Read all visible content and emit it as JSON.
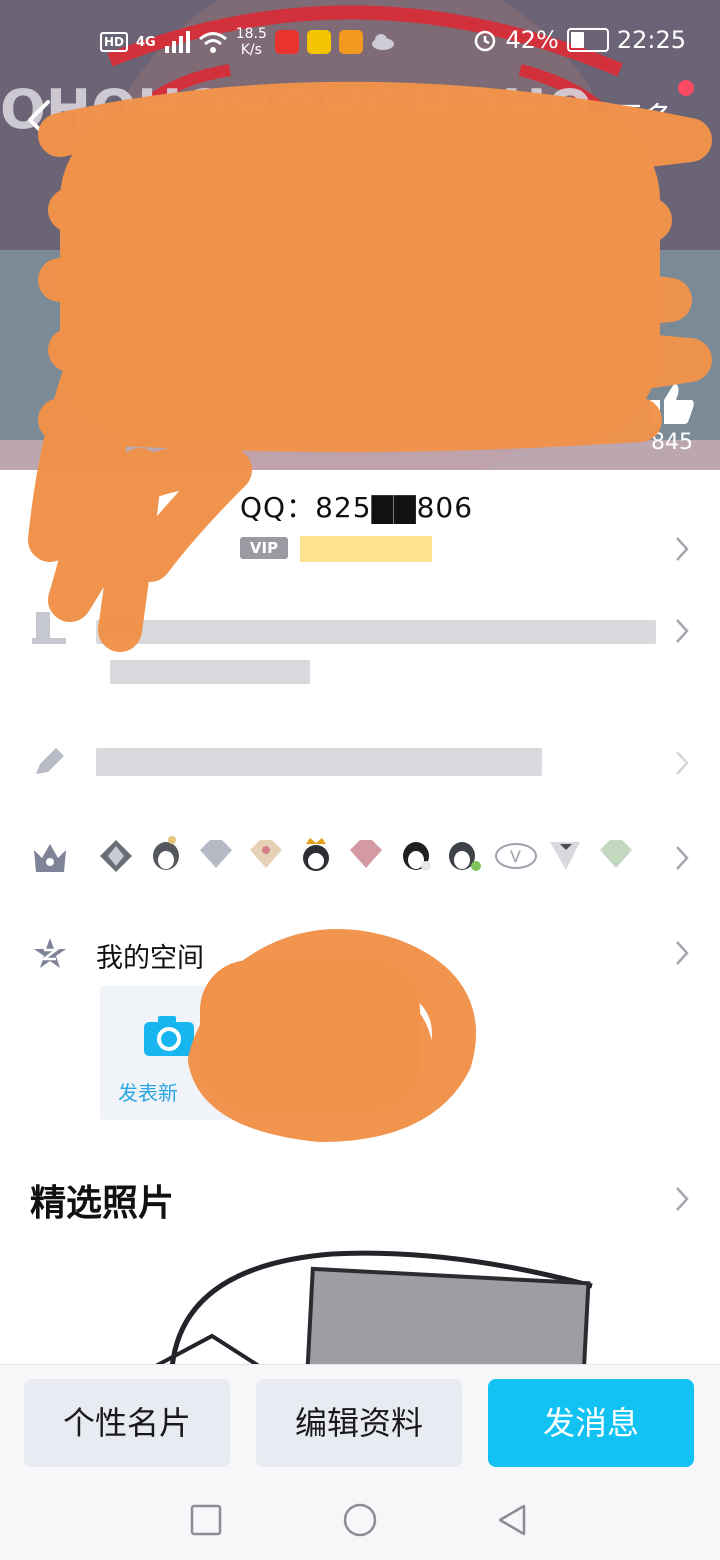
{
  "status_bar": {
    "left_badges": [
      "HD",
      "4G"
    ],
    "net_speed_value": "18.5",
    "net_speed_unit": "K/s",
    "battery": "42%",
    "time": "22:25"
  },
  "header": {
    "more_label": "更多",
    "cover_text": "OHOHOHOHOHOHO",
    "like_count": "845"
  },
  "profile": {
    "qq_line": "QQ：825▇▇806",
    "vip_label": "VIP"
  },
  "space": {
    "title": "我的空间",
    "post_label": "发表新"
  },
  "photos": {
    "title": "精选照片"
  },
  "actions": {
    "card_label": "个性名片",
    "edit_label": "编辑资料",
    "message_label": "发消息"
  },
  "colors": {
    "accent": "#12c2f3",
    "scribble": "#f0924a",
    "vip_gold": "#ffdc7a",
    "notification_dot": "#ff4a64"
  },
  "icons": [
    "back-arrow-icon",
    "qr-code-icon",
    "thumbs-up-icon",
    "chevron-right-icon",
    "pencil-icon",
    "crown-icon",
    "z-star-icon",
    "camera-icon",
    "square-nav-icon",
    "circle-nav-icon",
    "triangle-back-nav-icon"
  ]
}
